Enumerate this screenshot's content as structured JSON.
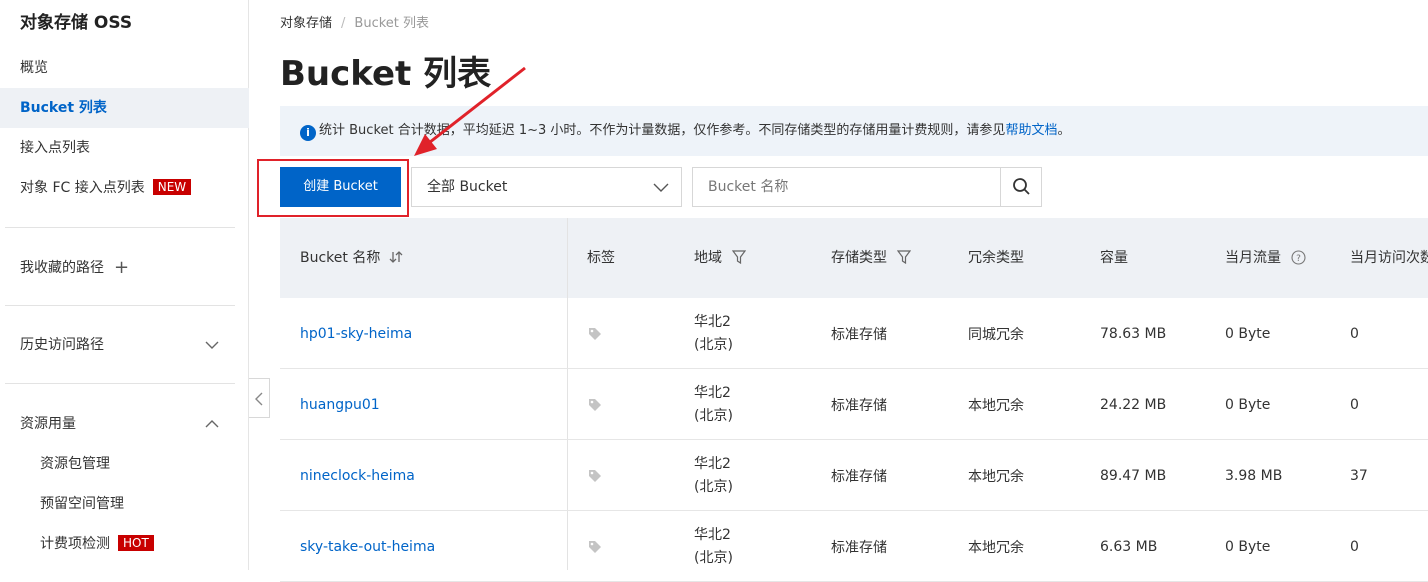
{
  "sidebar": {
    "title": "对象存储 OSS",
    "items": [
      {
        "label": "概览"
      },
      {
        "label": "Bucket 列表"
      },
      {
        "label": "接入点列表"
      },
      {
        "label": "对象 FC 接入点列表",
        "badge": "NEW"
      }
    ],
    "favorites_label": "我收藏的路径",
    "history_label": "历史访问路径",
    "resources_label": "资源用量",
    "resource_items": [
      {
        "label": "资源包管理"
      },
      {
        "label": "预留空间管理"
      },
      {
        "label": "计费项检测",
        "badge": "HOT"
      }
    ]
  },
  "breadcrumb": {
    "root": "对象存储",
    "separator": "/",
    "current": "Bucket 列表"
  },
  "page_title": "Bucket 列表",
  "notice": {
    "icon": "info-icon",
    "text": "统计 Bucket 合计数据，平均延迟 1~3 小时。不作为计量数据，仅作参考。不同存储类型的存储用量计费规则，请参见",
    "link": "帮助文档",
    "suffix": "。"
  },
  "toolbar": {
    "create_label": "创建 Bucket",
    "filter_selected": "全部 Bucket",
    "search_placeholder": "Bucket 名称"
  },
  "table": {
    "headers": {
      "name": "Bucket 名称",
      "tags": "标签",
      "region": "地域",
      "storage_class": "存储类型",
      "redundancy": "冗余类型",
      "capacity": "容量",
      "traffic": "当月流量",
      "requests": "当月访问次数"
    },
    "rows": [
      {
        "name": "hp01-sky-heima",
        "region_line1": "华北2",
        "region_line2": "(北京)",
        "storage_class": "标准存储",
        "redundancy": "同城冗余",
        "capacity": "78.63 MB",
        "traffic": "0 Byte",
        "requests": "0"
      },
      {
        "name": "huangpu01",
        "region_line1": "华北2",
        "region_line2": "(北京)",
        "storage_class": "标准存储",
        "redundancy": "本地冗余",
        "capacity": "24.22 MB",
        "traffic": "0 Byte",
        "requests": "0"
      },
      {
        "name": "nineclock-heima",
        "region_line1": "华北2",
        "region_line2": "(北京)",
        "storage_class": "标准存储",
        "redundancy": "本地冗余",
        "capacity": "89.47 MB",
        "traffic": "3.98 MB",
        "requests": "37"
      },
      {
        "name": "sky-take-out-heima",
        "region_line1": "华北2",
        "region_line2": "(北京)",
        "storage_class": "标准存储",
        "redundancy": "本地冗余",
        "capacity": "6.63 MB",
        "traffic": "0 Byte",
        "requests": "0"
      }
    ]
  },
  "colors": {
    "accent": "#0064c8",
    "annotation": "#e0222a",
    "badge": "#c80000",
    "header_bg": "#eef1f5"
  }
}
